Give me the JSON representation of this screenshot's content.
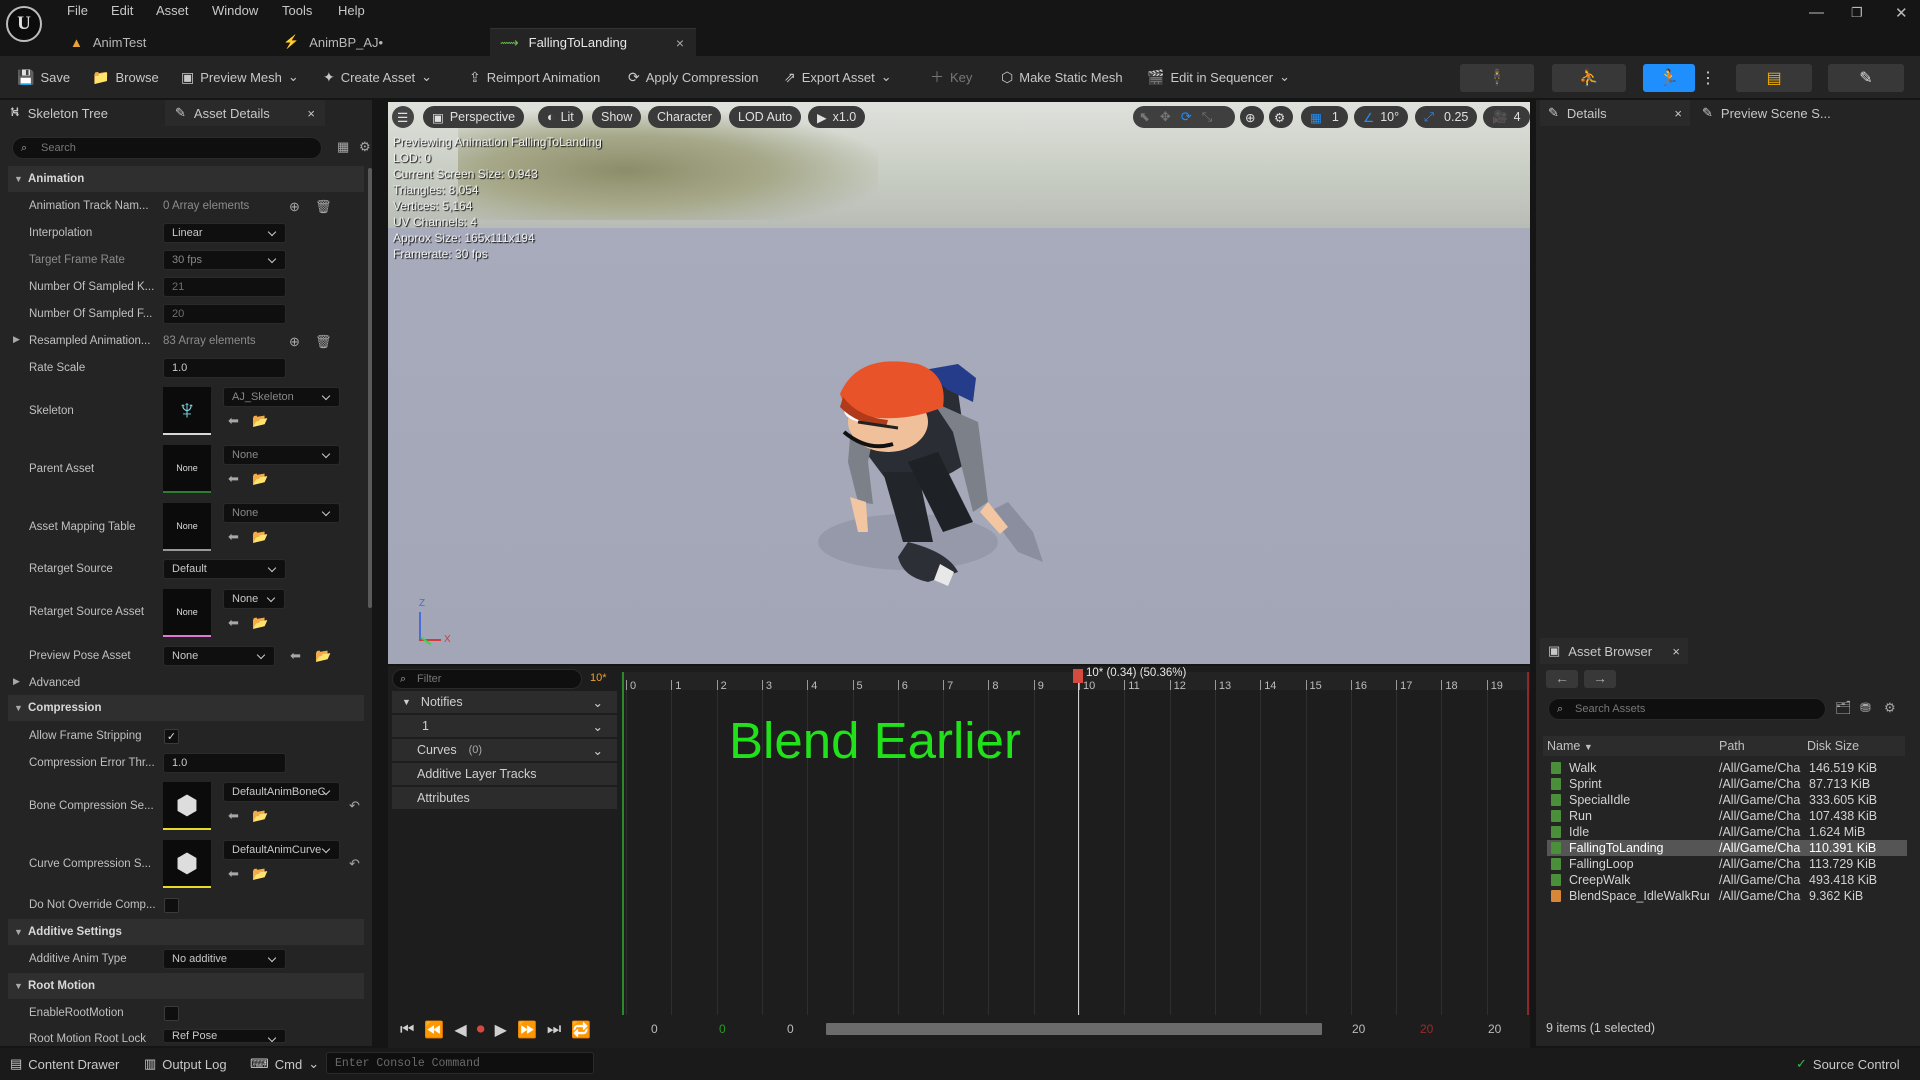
{
  "menu": [
    "File",
    "Edit",
    "Asset",
    "Window",
    "Tools",
    "Help"
  ],
  "window_controls": {
    "minimize": "—",
    "restore": "❐",
    "close": "✕"
  },
  "tabs": [
    {
      "label": "AnimTest"
    },
    {
      "label": "AnimBP_AJ•"
    },
    {
      "label": "FallingToLanding",
      "close": "×"
    }
  ],
  "toolbar": {
    "save": "Save",
    "browse": "Browse",
    "preview_mesh": "Preview Mesh",
    "create_asset": "Create Asset",
    "reimport": "Reimport Animation",
    "apply_compression": "Apply Compression",
    "export_asset": "Export Asset",
    "key": "Key",
    "make_static_mesh": "Make Static Mesh",
    "edit_in_sequencer": "Edit in Sequencer"
  },
  "left_panel": {
    "tab_skeleton": "Skeleton Tree",
    "tab_asset_details": "Asset Details",
    "search_placeholder": "Search",
    "sections": {
      "animation": "Animation",
      "advanced": "Advanced",
      "compression": "Compression",
      "additive": "Additive Settings",
      "root_motion": "Root Motion"
    },
    "rows": {
      "track_names": {
        "label": "Animation Track Nam...",
        "value": "0 Array elements"
      },
      "interpolation": {
        "label": "Interpolation",
        "value": "Linear"
      },
      "target_frame_rate": {
        "label": "Target Frame Rate",
        "value": "30 fps"
      },
      "num_sampled_keys": {
        "label": "Number Of Sampled K...",
        "value": "21"
      },
      "num_sampled_frames": {
        "label": "Number Of Sampled F...",
        "value": "20"
      },
      "resampled": {
        "label": "Resampled Animation...",
        "value": "83 Array elements"
      },
      "rate_scale": {
        "label": "Rate Scale",
        "value": "1.0"
      },
      "skeleton": {
        "label": "Skeleton",
        "value": "AJ_Skeleton"
      },
      "parent_asset": {
        "label": "Parent Asset",
        "value": "None",
        "thumb": "None"
      },
      "mapping_table": {
        "label": "Asset Mapping Table",
        "value": "None",
        "thumb": "None"
      },
      "retarget_source": {
        "label": "Retarget Source",
        "value": "Default"
      },
      "retarget_source_asset": {
        "label": "Retarget Source Asset",
        "value": "None",
        "thumb": "None"
      },
      "preview_pose": {
        "label": "Preview Pose Asset",
        "value": "None"
      },
      "allow_frame_stripping": {
        "label": "Allow Frame Stripping",
        "checked": "✓"
      },
      "compression_error": {
        "label": "Compression Error Thr...",
        "value": "1.0"
      },
      "bone_compression": {
        "label": "Bone Compression Se...",
        "value": "DefaultAnimBoneC"
      },
      "curve_compression": {
        "label": "Curve Compression S...",
        "value": "DefaultAnimCurve"
      },
      "do_not_override": {
        "label": "Do Not Override Comp..."
      },
      "additive_anim_type": {
        "label": "Additive Anim Type",
        "value": "No additive"
      },
      "enable_root_motion": {
        "label": "EnableRootMotion"
      },
      "root_motion_root_lock": {
        "label": "Root Motion Root Lock",
        "value": "Ref Pose"
      }
    }
  },
  "viewport": {
    "perspective": "Perspective",
    "lit": "Lit",
    "show": "Show",
    "character": "Character",
    "lod": "LOD Auto",
    "speed": "x1.0",
    "grid_value": "1",
    "angle_value": "10°",
    "scale_value": "0.25",
    "camera_value": "4",
    "stats": [
      "Previewing Animation FallingToLanding",
      "LOD: 0",
      "Current Screen Size: 0.943",
      "Triangles: 8,054",
      "Vertices: 5,164",
      "UV Channels: 4",
      "Approx Size: 165x111x194",
      "Framerate: 30 fps"
    ],
    "axis_z": "Z",
    "axis_x": "X"
  },
  "timeline": {
    "filter_placeholder": "Filter",
    "frame_badge": "10*",
    "playhead_label": "10* (0.34) (50.36%)",
    "ticks": [
      "0",
      "1",
      "2",
      "3",
      "4",
      "5",
      "6",
      "7",
      "8",
      "9",
      "10",
      "11",
      "12",
      "13",
      "14",
      "15",
      "16",
      "17",
      "18",
      "19"
    ],
    "notifies": "Notifies",
    "track_1": "1",
    "curves": "Curves",
    "curves_count": "(0)",
    "additive_layer": "Additive Layer Tracks",
    "attributes": "Attributes",
    "overlay_text": "Blend Earlier",
    "range": {
      "start_a": "0",
      "start_b": "0",
      "start_c": "0",
      "end_a": "20",
      "end_b": "20",
      "end_c": "20"
    }
  },
  "right_panel": {
    "tab_details": "Details",
    "tab_preview_scene": "Preview Scene S...",
    "asset_browser_title": "Asset Browser",
    "search_placeholder": "Search Assets",
    "columns": {
      "name": "Name",
      "path": "Path",
      "size": "Disk Size"
    },
    "assets": [
      {
        "name": "Walk",
        "path": "/All/Game/Cha",
        "size": "146.519 KiB"
      },
      {
        "name": "Sprint",
        "path": "/All/Game/Cha",
        "size": "87.713 KiB"
      },
      {
        "name": "SpecialIdle",
        "path": "/All/Game/Cha",
        "size": "333.605 KiB"
      },
      {
        "name": "Run",
        "path": "/All/Game/Cha",
        "size": "107.438 KiB"
      },
      {
        "name": "Idle",
        "path": "/All/Game/Cha",
        "size": "1.624 MiB"
      },
      {
        "name": "FallingToLanding",
        "path": "/All/Game/Cha",
        "size": "110.391 KiB"
      },
      {
        "name": "FallingLoop",
        "path": "/All/Game/Cha",
        "size": "113.729 KiB"
      },
      {
        "name": "CreepWalk",
        "path": "/All/Game/Cha",
        "size": "493.418 KiB"
      },
      {
        "name": "BlendSpace_IdleWalkRun",
        "path": "/All/Game/Cha",
        "size": "9.362 KiB"
      }
    ],
    "footer": "9 items (1 selected)"
  },
  "statusbar": {
    "content_drawer": "Content Drawer",
    "output_log": "Output Log",
    "cmd": "Cmd",
    "console_placeholder": "Enter Console Command",
    "source_control": "Source Control"
  },
  "colors": {
    "accent_blue": "#1e8ffc",
    "overlay_green": "#21e21a",
    "playhead_red": "#d54a3f",
    "cap_orange": "#e8532a",
    "sky": "#a4a8b8"
  }
}
